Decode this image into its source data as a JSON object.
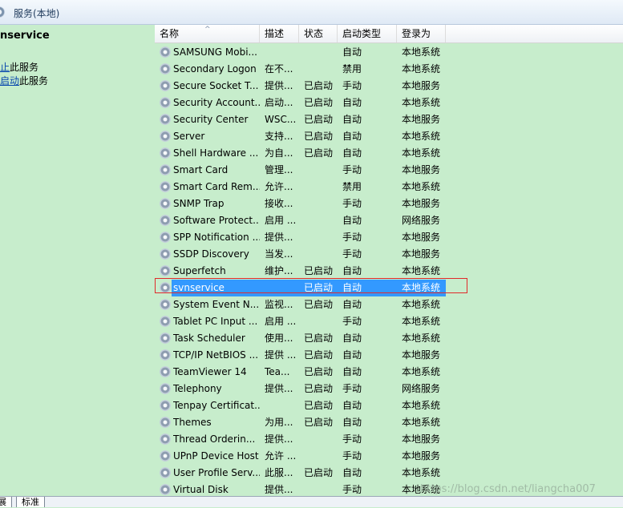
{
  "window": {
    "title": "服务(本地)"
  },
  "left_pane": {
    "service_name": "nservice",
    "actions": [
      {
        "link": "止",
        "suffix": "此服务"
      },
      {
        "link": "启动",
        "suffix": "此服务"
      }
    ]
  },
  "table": {
    "columns": [
      {
        "key": "name",
        "label": "名称",
        "sort": "ascending"
      },
      {
        "key": "desc",
        "label": "描述"
      },
      {
        "key": "status",
        "label": "状态"
      },
      {
        "key": "startup",
        "label": "启动类型"
      },
      {
        "key": "logon",
        "label": "登录为"
      }
    ],
    "rows": [
      {
        "name": "SAMSUNG Mobi...",
        "desc": "",
        "status": "",
        "startup": "自动",
        "logon": "本地系统"
      },
      {
        "name": "Secondary Logon",
        "desc": "在不...",
        "status": "",
        "startup": "禁用",
        "logon": "本地系统"
      },
      {
        "name": "Secure Socket T...",
        "desc": "提供...",
        "status": "已启动",
        "startup": "手动",
        "logon": "本地服务"
      },
      {
        "name": "Security Account...",
        "desc": "启动...",
        "status": "已启动",
        "startup": "自动",
        "logon": "本地系统"
      },
      {
        "name": "Security Center",
        "desc": "WSC...",
        "status": "已启动",
        "startup": "自动",
        "logon": "本地服务"
      },
      {
        "name": "Server",
        "desc": "支持...",
        "status": "已启动",
        "startup": "自动",
        "logon": "本地系统"
      },
      {
        "name": "Shell Hardware ...",
        "desc": "为自...",
        "status": "已启动",
        "startup": "自动",
        "logon": "本地系统"
      },
      {
        "name": "Smart Card",
        "desc": "管理...",
        "status": "",
        "startup": "手动",
        "logon": "本地服务"
      },
      {
        "name": "Smart Card Rem...",
        "desc": "允许...",
        "status": "",
        "startup": "禁用",
        "logon": "本地系统"
      },
      {
        "name": "SNMP Trap",
        "desc": "接收...",
        "status": "",
        "startup": "手动",
        "logon": "本地服务"
      },
      {
        "name": "Software Protect...",
        "desc": "启用 ...",
        "status": "",
        "startup": "自动",
        "logon": "网络服务"
      },
      {
        "name": "SPP Notification ...",
        "desc": "提供...",
        "status": "",
        "startup": "手动",
        "logon": "本地服务"
      },
      {
        "name": "SSDP Discovery",
        "desc": "当发...",
        "status": "",
        "startup": "手动",
        "logon": "本地服务"
      },
      {
        "name": "Superfetch",
        "desc": "维护...",
        "status": "已启动",
        "startup": "自动",
        "logon": "本地系统"
      },
      {
        "name": "svnservice",
        "desc": "",
        "status": "已启动",
        "startup": "自动",
        "logon": "本地系统",
        "selected": true
      },
      {
        "name": "System Event N...",
        "desc": "监视...",
        "status": "已启动",
        "startup": "自动",
        "logon": "本地系统"
      },
      {
        "name": "Tablet PC Input ...",
        "desc": "启用 ...",
        "status": "",
        "startup": "手动",
        "logon": "本地系统"
      },
      {
        "name": "Task Scheduler",
        "desc": "使用...",
        "status": "已启动",
        "startup": "自动",
        "logon": "本地系统"
      },
      {
        "name": "TCP/IP NetBIOS ...",
        "desc": "提供 ...",
        "status": "已启动",
        "startup": "自动",
        "logon": "本地服务"
      },
      {
        "name": "TeamViewer 14",
        "desc": "Tea...",
        "status": "已启动",
        "startup": "自动",
        "logon": "本地系统"
      },
      {
        "name": "Telephony",
        "desc": "提供...",
        "status": "已启动",
        "startup": "手动",
        "logon": "网络服务"
      },
      {
        "name": "Tenpay Certificat...",
        "desc": "",
        "status": "已启动",
        "startup": "自动",
        "logon": "本地系统"
      },
      {
        "name": "Themes",
        "desc": "为用...",
        "status": "已启动",
        "startup": "自动",
        "logon": "本地系统"
      },
      {
        "name": "Thread Orderin...",
        "desc": "提供...",
        "status": "",
        "startup": "手动",
        "logon": "本地服务"
      },
      {
        "name": "UPnP Device Host",
        "desc": "允许 ...",
        "status": "",
        "startup": "手动",
        "logon": "本地服务"
      },
      {
        "name": "User Profile Serv...",
        "desc": "此服...",
        "status": "已启动",
        "startup": "自动",
        "logon": "本地系统"
      },
      {
        "name": "Virtual Disk",
        "desc": "提供...",
        "status": "",
        "startup": "手动",
        "logon": "本地系统"
      }
    ]
  },
  "bottom_tabs": [
    "展",
    "标准"
  ],
  "watermark": "https://blog.csdn.net/liangcha007",
  "colors": {
    "background": "#c7edcc",
    "selection": "#3399ff",
    "highlight_border": "#e02a2a"
  },
  "icons": {
    "service": "gear-icon",
    "window": "services-icon"
  }
}
